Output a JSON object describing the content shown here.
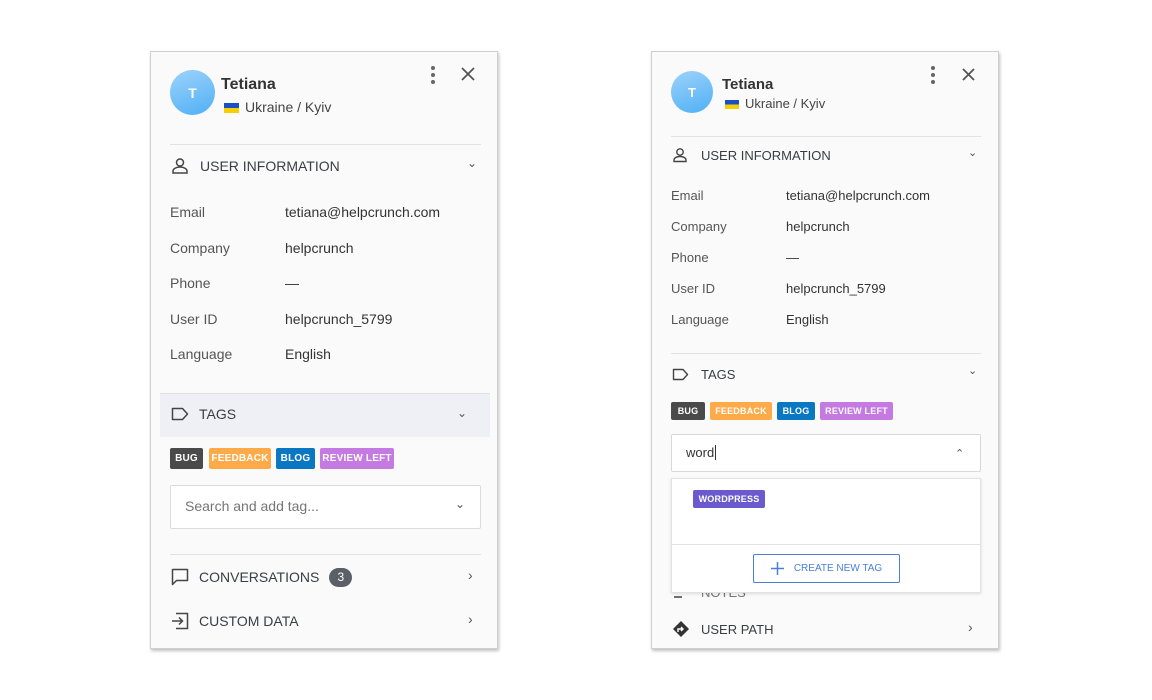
{
  "left_panel": {
    "user": {
      "initial": "T",
      "name": "Tetiana",
      "location": "Ukraine / Kyiv"
    },
    "sections": {
      "user_info": "USER INFORMATION",
      "tags": "TAGS",
      "conversations": "CONVERSATIONS",
      "conversations_count": "3",
      "custom_data": "CUSTOM DATA"
    },
    "fields": [
      {
        "label": "Email",
        "value": "tetiana@helpcrunch.com"
      },
      {
        "label": "Company",
        "value": "helpcrunch"
      },
      {
        "label": "Phone",
        "value": "—"
      },
      {
        "label": "User ID",
        "value": "helpcrunch_5799"
      },
      {
        "label": "Language",
        "value": "English"
      }
    ],
    "tags": [
      {
        "label": "BUG",
        "color": "#4a4a4a"
      },
      {
        "label": "FEEDBACK",
        "color": "#fdaa48"
      },
      {
        "label": "BLOG",
        "color": "#0a77c2"
      },
      {
        "label": "REVIEW LEFT",
        "color": "#c47ae0"
      }
    ],
    "tag_search": {
      "placeholder": "Search and add tag...",
      "value": ""
    }
  },
  "right_panel": {
    "user": {
      "initial": "T",
      "name": "Tetiana",
      "location": "Ukraine / Kyiv"
    },
    "sections": {
      "user_info": "USER INFORMATION",
      "tags": "TAGS",
      "notes": "NOTES",
      "user_path": "USER PATH"
    },
    "fields": [
      {
        "label": "Email",
        "value": "tetiana@helpcrunch.com"
      },
      {
        "label": "Company",
        "value": "helpcrunch"
      },
      {
        "label": "Phone",
        "value": "—"
      },
      {
        "label": "User ID",
        "value": "helpcrunch_5799"
      },
      {
        "label": "Language",
        "value": "English"
      }
    ],
    "tags": [
      {
        "label": "BUG",
        "color": "#4a4a4a"
      },
      {
        "label": "FEEDBACK",
        "color": "#fdaa48"
      },
      {
        "label": "BLOG",
        "color": "#0a77c2"
      },
      {
        "label": "REVIEW LEFT",
        "color": "#c47ae0"
      }
    ],
    "tag_search": {
      "value": "word"
    },
    "suggestions": [
      {
        "label": "WORDPRESS",
        "color": "#6a5acd"
      }
    ],
    "create_button": "CREATE NEW TAG"
  }
}
